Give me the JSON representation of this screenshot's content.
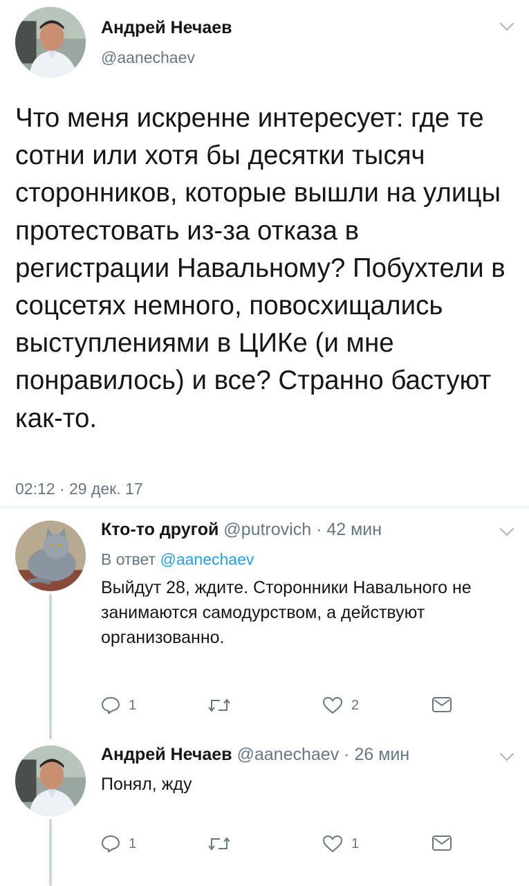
{
  "main_tweet": {
    "author_name": "Андрей Нечаев",
    "author_handle": "@aanechaev",
    "text": "Что меня искренне интересует: где те сотни или хотя бы десятки тысяч сторонников, которые вышли на улицы протестовать из-за отказа в регистрации Навальному? Побухтели в соцсетях немного, повосхищались выступлениями в ЦИКе (и мне понравилось) и все? Странно бастуют как-то.",
    "timestamp": "02:12 · 29 дек. 17",
    "menu_icon": "chevron-down-icon",
    "avatar_icon": "profile-photo"
  },
  "replies": [
    {
      "author_name": "Кто-то другой",
      "author_handle": "@putrovich",
      "time": "· 42 мин",
      "reply_prefix": "В ответ",
      "reply_to": "@aanechaev",
      "text": "Выйдут 28, ждите. Сторонники Навального не занимаются самодурством, а действуют организованно.",
      "reply_count": "1",
      "retweet_count": "",
      "like_count": "2",
      "avatar_icon": "cat-photo"
    },
    {
      "author_name": "Андрей Нечаев",
      "author_handle": "@aanechaev",
      "time": "· 26 мин",
      "text": "Понял, жду",
      "reply_count": "1",
      "retweet_count": "",
      "like_count": "1",
      "avatar_icon": "profile-photo"
    }
  ],
  "colors": {
    "text": "#14171a",
    "secondary": "#657786",
    "link": "#1da1f2",
    "thread_line": "#ccd6dd",
    "divider": "#e1e8ed"
  }
}
